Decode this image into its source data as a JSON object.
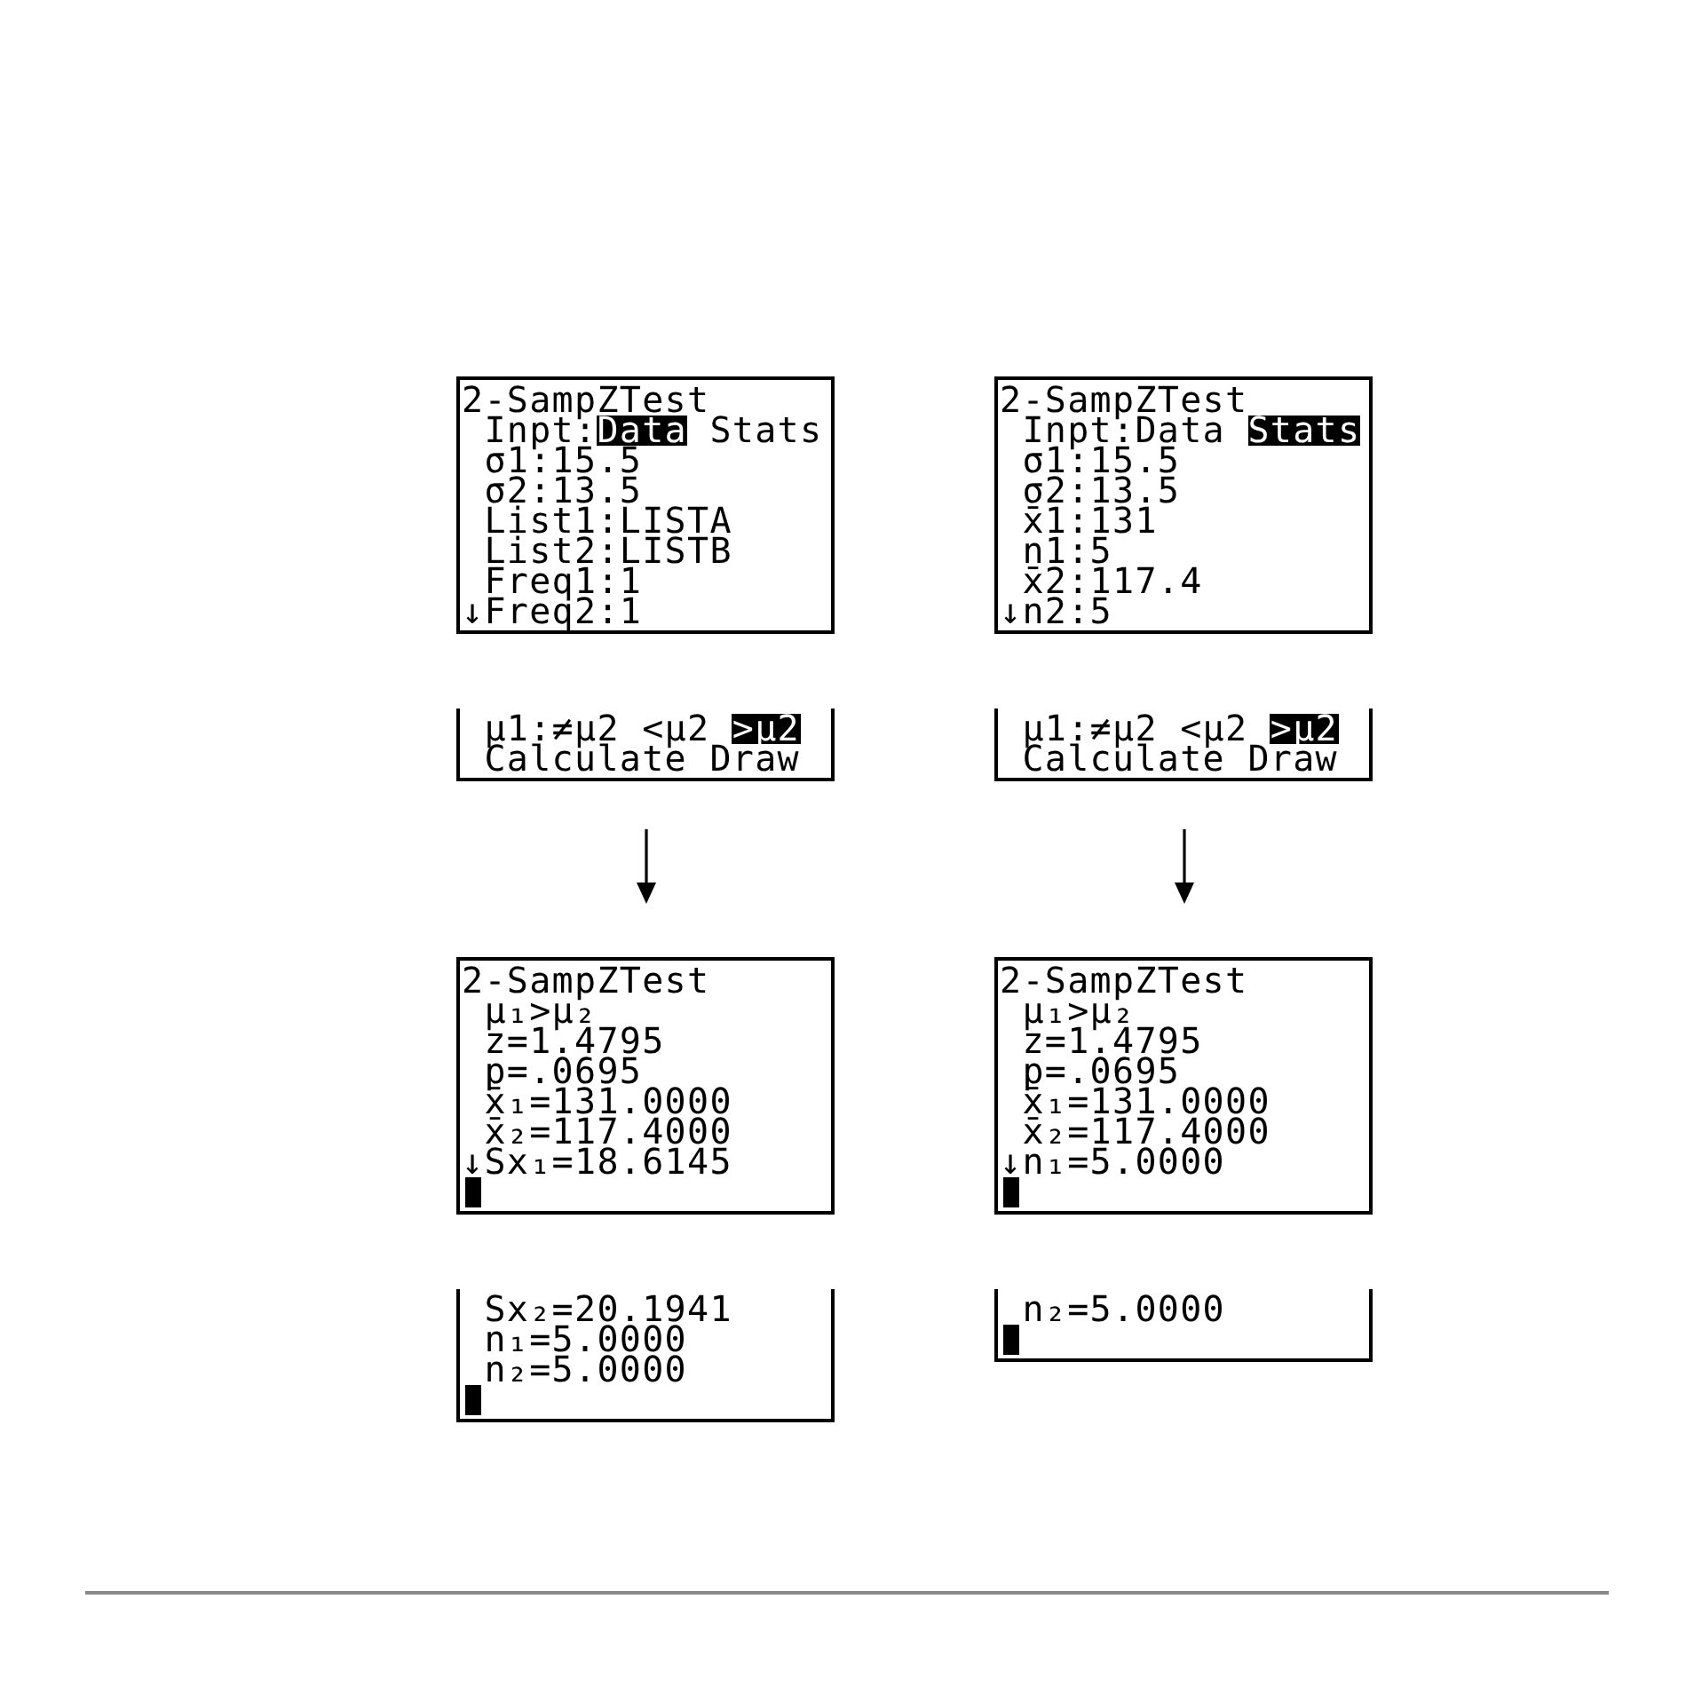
{
  "columns": [
    {
      "panels": [
        {
          "kind": "screen",
          "top_cut": false,
          "cursor": false,
          "lines": [
            {
              "kind": "title",
              "text": "2-SampZTest"
            },
            {
              "kind": "options",
              "label": "Inpt:",
              "options": [
                {
                  "label": "Data",
                  "selected": true
                },
                {
                  "label": "Stats",
                  "selected": false
                }
              ]
            },
            {
              "kind": "text",
              "text": "σ1:15.5"
            },
            {
              "kind": "text",
              "text": "σ2:13.5"
            },
            {
              "kind": "text",
              "text": "List1:LISTA"
            },
            {
              "kind": "text",
              "text": "List2:LISTB"
            },
            {
              "kind": "text",
              "text": "Freq1:1"
            },
            {
              "kind": "text",
              "prefix": "↓",
              "text": "Freq2:1"
            }
          ]
        },
        {
          "kind": "screen",
          "top_cut": true,
          "cursor": false,
          "lines": [
            {
              "kind": "options",
              "label": "μ1:",
              "options": [
                {
                  "label": "≠μ2",
                  "selected": false
                },
                {
                  "label": "<μ2",
                  "selected": false
                },
                {
                  "label": ">μ2",
                  "selected": true
                }
              ]
            },
            {
              "kind": "options",
              "options": [
                {
                  "label": "Calculate",
                  "selected": false
                },
                {
                  "label": "Draw",
                  "selected": false
                }
              ]
            }
          ]
        },
        {
          "kind": "arrow"
        },
        {
          "kind": "screen",
          "top_cut": false,
          "cursor": true,
          "lines": [
            {
              "kind": "title",
              "text": "2-SampZTest"
            },
            {
              "kind": "text",
              "text": "μ₁>μ₂"
            },
            {
              "kind": "text",
              "text": "z=1.4795"
            },
            {
              "kind": "text",
              "text": "p=.0695"
            },
            {
              "kind": "text",
              "text": "x̄₁=131.0000"
            },
            {
              "kind": "text",
              "text": "x̄₂=117.4000"
            },
            {
              "kind": "text",
              "prefix": "↓",
              "text": "Sx₁=18.6145"
            }
          ]
        },
        {
          "kind": "screen",
          "top_cut": true,
          "cursor": true,
          "lines": [
            {
              "kind": "text",
              "text": "Sx₂=20.1941"
            },
            {
              "kind": "text",
              "text": "n₁=5.0000"
            },
            {
              "kind": "text",
              "text": "n₂=5.0000"
            }
          ]
        }
      ]
    },
    {
      "panels": [
        {
          "kind": "screen",
          "top_cut": false,
          "cursor": false,
          "lines": [
            {
              "kind": "title",
              "text": "2-SampZTest"
            },
            {
              "kind": "options",
              "label": "Inpt:",
              "options": [
                {
                  "label": "Data",
                  "selected": false
                },
                {
                  "label": "Stats",
                  "selected": true
                }
              ]
            },
            {
              "kind": "text",
              "text": "σ1:15.5"
            },
            {
              "kind": "text",
              "text": "σ2:13.5"
            },
            {
              "kind": "text",
              "text": "x̄1:131"
            },
            {
              "kind": "text",
              "text": "n1:5"
            },
            {
              "kind": "text",
              "text": "x̄2:117.4"
            },
            {
              "kind": "text",
              "prefix": "↓",
              "text": "n2:5"
            }
          ]
        },
        {
          "kind": "screen",
          "top_cut": true,
          "cursor": false,
          "lines": [
            {
              "kind": "options",
              "label": "μ1:",
              "options": [
                {
                  "label": "≠μ2",
                  "selected": false
                },
                {
                  "label": "<μ2",
                  "selected": false
                },
                {
                  "label": ">μ2",
                  "selected": true
                }
              ]
            },
            {
              "kind": "options",
              "options": [
                {
                  "label": "Calculate",
                  "selected": false
                },
                {
                  "label": "Draw",
                  "selected": false
                }
              ]
            }
          ]
        },
        {
          "kind": "arrow"
        },
        {
          "kind": "screen",
          "top_cut": false,
          "cursor": true,
          "lines": [
            {
              "kind": "title",
              "text": "2-SampZTest"
            },
            {
              "kind": "text",
              "text": "μ₁>μ₂"
            },
            {
              "kind": "text",
              "text": "z=1.4795"
            },
            {
              "kind": "text",
              "text": "p=.0695"
            },
            {
              "kind": "text",
              "text": "x̄₁=131.0000"
            },
            {
              "kind": "text",
              "text": "x̄₂=117.4000"
            },
            {
              "kind": "text",
              "prefix": "↓",
              "text": "n₁=5.0000"
            }
          ]
        },
        {
          "kind": "screen",
          "top_cut": true,
          "cursor": true,
          "lines": [
            {
              "kind": "text",
              "text": "n₂=5.0000"
            }
          ]
        }
      ]
    }
  ]
}
